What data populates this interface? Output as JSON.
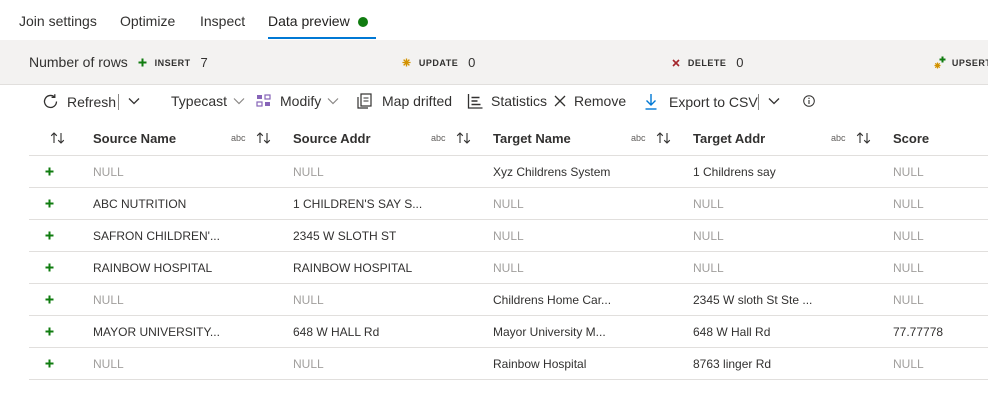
{
  "tabs": [
    {
      "label": "Join settings"
    },
    {
      "label": "Optimize"
    },
    {
      "label": "Inspect"
    },
    {
      "label": "Data preview",
      "active": true,
      "status": "success"
    }
  ],
  "stats": {
    "rows_label": "Number of rows",
    "insert_label": "INSERT",
    "insert_value": "7",
    "update_label": "UPDATE",
    "update_value": "0",
    "delete_label": "DELETE",
    "delete_value": "0",
    "upsert_label": "UPSERT"
  },
  "toolbar": {
    "refresh": "Refresh",
    "typecast": "Typecast",
    "modify": "Modify",
    "map_drifted": "Map drifted",
    "statistics": "Statistics",
    "remove": "Remove",
    "export_csv": "Export to CSV"
  },
  "columns": [
    {
      "name": "Source Name",
      "type": "abc"
    },
    {
      "name": "Source Addr",
      "type": "abc"
    },
    {
      "name": "Target Name",
      "type": "abc"
    },
    {
      "name": "Target Addr",
      "type": "abc"
    },
    {
      "name": "Score"
    }
  ],
  "rows": [
    [
      "NULL",
      "NULL",
      "Xyz Childrens System",
      "1 Childrens say",
      "NULL"
    ],
    [
      "ABC NUTRITION",
      "1 CHILDREN'S SAY S...",
      "NULL",
      "NULL",
      "NULL"
    ],
    [
      "SAFRON CHILDREN'...",
      "2345 W SLOTH ST",
      "NULL",
      "NULL",
      "NULL"
    ],
    [
      "RAINBOW HOSPITAL",
      "RAINBOW HOSPITAL",
      "NULL",
      "NULL",
      "NULL"
    ],
    [
      "NULL",
      "NULL",
      "Childrens Home Car...",
      "2345 W sloth St Ste ...",
      "NULL"
    ],
    [
      "MAYOR UNIVERSITY...",
      "648 W HALL Rd",
      "Mayor University M...",
      "648 W Hall Rd",
      "77.77778"
    ],
    [
      "NULL",
      "NULL",
      "Rainbow Hospital",
      "8763 linger Rd",
      "NULL"
    ]
  ],
  "colors": {
    "accent": "#0078d4",
    "insert": "#107c10",
    "update": "#d29200",
    "delete": "#a4262c"
  },
  "icons": [
    "refresh-icon",
    "chevron-down-icon",
    "typecast-icon",
    "modify-icon",
    "map-drifted-icon",
    "statistics-icon",
    "remove-icon",
    "export-icon",
    "info-icon",
    "sort-icon",
    "plus-icon"
  ]
}
